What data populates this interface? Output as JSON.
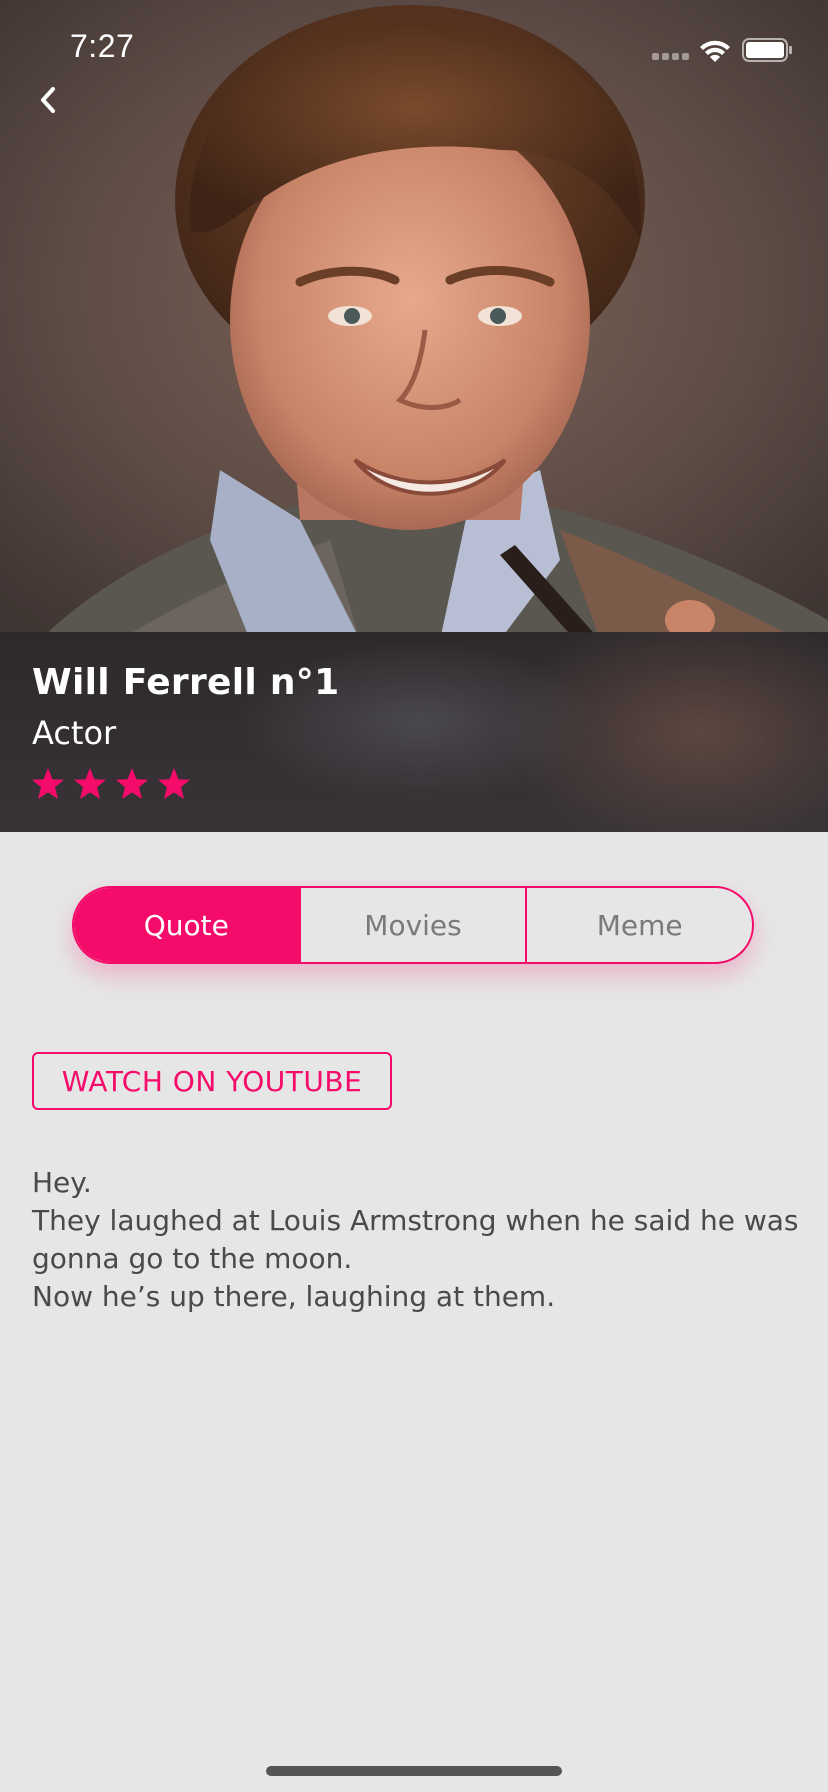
{
  "status_bar": {
    "time": "7:27"
  },
  "header": {
    "back_icon": "chevron-left-icon"
  },
  "profile": {
    "name": "Will Ferrell n°1",
    "role": "Actor",
    "rating": 4,
    "rating_max": 4,
    "star_icon": "star-icon",
    "accent_color": "#f50b6a"
  },
  "tabs": [
    {
      "label": "Quote",
      "active": true
    },
    {
      "label": "Movies",
      "active": false
    },
    {
      "label": "Meme",
      "active": false
    }
  ],
  "actions": {
    "youtube_label": "WATCH ON YOUTUBE"
  },
  "quote": {
    "lines": [
      "Hey.",
      "They laughed at Louis Armstrong when he said he was gonna go to the moon.",
      "Now he’s up there, laughing at them."
    ]
  }
}
